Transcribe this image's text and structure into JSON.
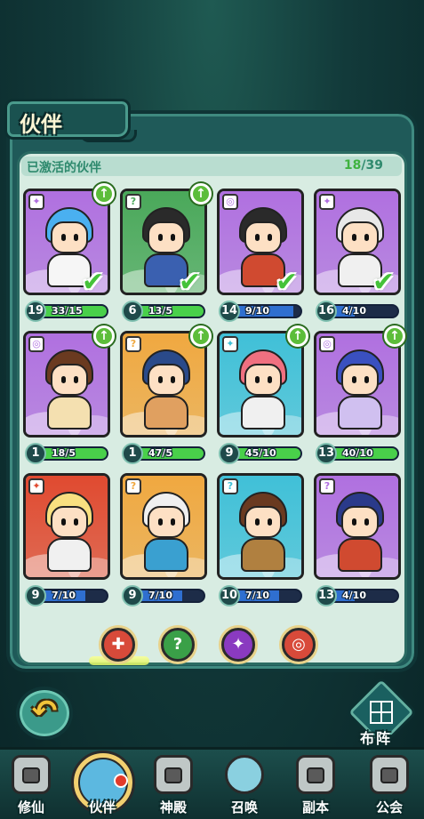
{
  "header": {
    "title": "伙伴"
  },
  "section": {
    "subtitle": "已激活的伙伴",
    "count_owned": "18",
    "count_sep": "/",
    "count_total": "39"
  },
  "cards": [
    {
      "level": "19",
      "progress": "33/15",
      "fill": 1.0,
      "bar": "green",
      "element": "✦",
      "upgrade": true,
      "done": true,
      "theme": "#b070e0",
      "hair": "#4ab0f0",
      "outfit": "#f6f6f6"
    },
    {
      "level": "6",
      "progress": "13/5",
      "fill": 1.0,
      "bar": "green",
      "element": "?",
      "upgrade": true,
      "done": true,
      "theme": "#4aa85a",
      "hair": "#2a2a2a",
      "outfit": "#3a60b0"
    },
    {
      "level": "14",
      "progress": "9/10",
      "fill": 0.9,
      "bar": "blue",
      "element": "◎",
      "upgrade": false,
      "done": true,
      "theme": "#b070e0",
      "hair": "#2a2a2a",
      "outfit": "#d04a30"
    },
    {
      "level": "16",
      "progress": "4/10",
      "fill": 0.4,
      "bar": "blue",
      "element": "✦",
      "upgrade": false,
      "done": true,
      "theme": "#b070e0",
      "hair": "#e8e8e8",
      "outfit": "#f0f0f0"
    },
    {
      "level": "1",
      "progress": "18/5",
      "fill": 1.0,
      "bar": "green",
      "element": "◎",
      "upgrade": true,
      "done": false,
      "theme": "#b070e0",
      "hair": "#6a3a20",
      "outfit": "#f4e0b0"
    },
    {
      "level": "1",
      "progress": "47/5",
      "fill": 1.0,
      "bar": "green",
      "element": "?",
      "upgrade": true,
      "done": false,
      "theme": "#f0a840",
      "hair": "#2a4a8a",
      "outfit": "#e0a060"
    },
    {
      "level": "9",
      "progress": "45/10",
      "fill": 1.0,
      "bar": "green",
      "element": "✦",
      "upgrade": true,
      "done": false,
      "theme": "#40c0d8",
      "hair": "#f07080",
      "outfit": "#f0f0f0"
    },
    {
      "level": "13",
      "progress": "40/10",
      "fill": 1.0,
      "bar": "green",
      "element": "◎",
      "upgrade": true,
      "done": false,
      "theme": "#b070e0",
      "hair": "#3a50c0",
      "outfit": "#d0c0f0"
    },
    {
      "level": "9",
      "progress": "7/10",
      "fill": 0.7,
      "bar": "blue",
      "element": "✦",
      "upgrade": false,
      "done": false,
      "theme": "#e04a30",
      "hair": "#f8e080",
      "outfit": "#f0f0f0"
    },
    {
      "level": "9",
      "progress": "7/10",
      "fill": 0.7,
      "bar": "blue",
      "element": "?",
      "upgrade": false,
      "done": false,
      "theme": "#f0a840",
      "hair": "#f0f0f0",
      "outfit": "#3aa0d0"
    },
    {
      "level": "10",
      "progress": "7/10",
      "fill": 0.7,
      "bar": "blue",
      "element": "?",
      "upgrade": false,
      "done": false,
      "theme": "#40c0d8",
      "hair": "#6a3a20",
      "outfit": "#b08040"
    },
    {
      "level": "13",
      "progress": "4/10",
      "fill": 0.4,
      "bar": "blue",
      "element": "?",
      "upgrade": false,
      "done": false,
      "theme": "#b070e0",
      "hair": "#2a3a8a",
      "outfit": "#d04a30"
    }
  ],
  "filters": [
    {
      "name": "all-filter",
      "glyph": "✚",
      "color": "#d84a3a"
    },
    {
      "name": "wood-filter",
      "glyph": "?",
      "color": "#3aa048"
    },
    {
      "name": "thunder-filter",
      "glyph": "✦",
      "color": "#8a3ac0"
    },
    {
      "name": "cloud-filter",
      "glyph": "◎",
      "color": "#d84a3a"
    }
  ],
  "buttons": {
    "back_glyph": "↶",
    "formation_label": "布阵"
  },
  "nav": [
    {
      "label": "修仙",
      "locked": true
    },
    {
      "label": "伙伴",
      "locked": false
    },
    {
      "label": "神殿",
      "locked": true
    },
    {
      "label": "召唤",
      "locked": false
    },
    {
      "label": "副本",
      "locked": true
    },
    {
      "label": "公会",
      "locked": true
    }
  ]
}
